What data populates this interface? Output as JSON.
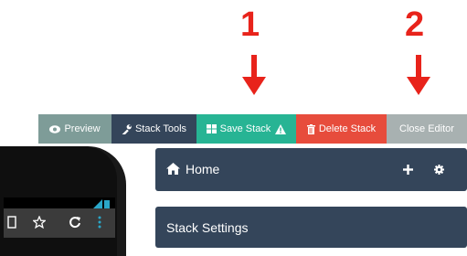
{
  "callouts": [
    {
      "number": "1"
    },
    {
      "number": "2"
    }
  ],
  "toolbar": {
    "preview_label": "Preview",
    "stack_tools_label": "Stack Tools",
    "save_stack_label": "Save Stack",
    "delete_stack_label": "Delete Stack",
    "close_editor_label": "Close Editor"
  },
  "panels": {
    "home_title": "Home",
    "stack_settings_title": "Stack Settings"
  },
  "colors": {
    "callout": "#e8231b",
    "preview": "#7e9c98",
    "stack_tools": "#34455a",
    "save_stack": "#27b494",
    "delete_stack": "#e74c3c",
    "close_editor": "#a8b1b1",
    "panel": "#34455a"
  },
  "icons": {
    "preview": "eye-icon",
    "stack_tools": "wrench-icon",
    "save_stack": "grid-icon",
    "save_warning": "warning-icon",
    "delete_stack": "trash-icon",
    "home": "home-icon",
    "add": "plus-icon",
    "settings": "gear-icon"
  }
}
